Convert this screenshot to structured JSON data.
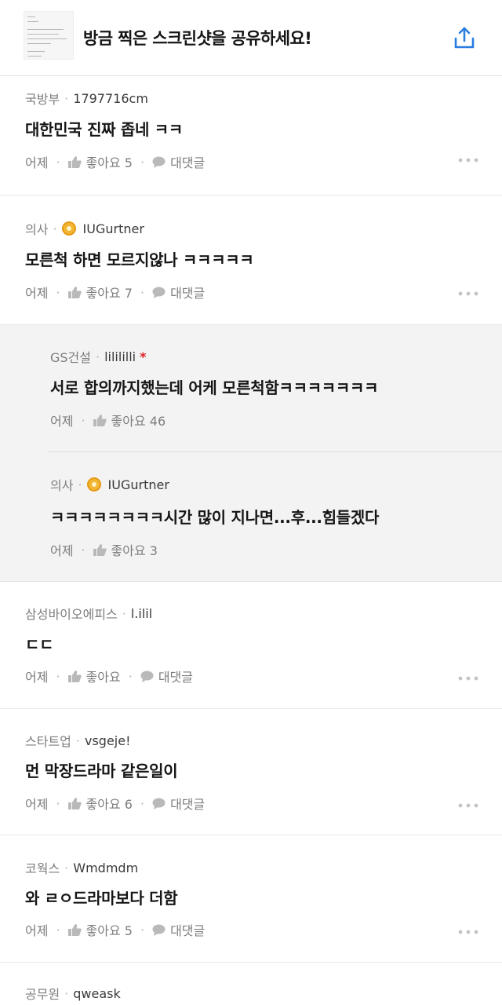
{
  "header": {
    "title": "방금 찍은 스크린샷을 공유하세요!"
  },
  "comments": [
    {
      "company": "국방부",
      "user": "1797716cm",
      "text": "대한민국 진짜 좁네 ㅋㅋ",
      "time": "어제",
      "like": "좋아요 5",
      "reply": "대댓글"
    },
    {
      "company": "의사",
      "user": "IUGurtner",
      "text": "모른척 하면 모르지않나 ㅋㅋㅋㅋㅋ",
      "time": "어제",
      "like": "좋아요 7",
      "reply": "대댓글"
    },
    {
      "company": "GS건설",
      "user": "lilililli",
      "text": "서로 합의까지했는데 어케 모른척함ㅋㅋㅋㅋㅋㅋㅋ",
      "time": "어제",
      "like": "좋아요 46",
      "author_mark": "*"
    },
    {
      "company": "의사",
      "user": "IUGurtner",
      "text": "ㅋㅋㅋㅋㅋㅋㅋㅋ시간 많이 지나면...후...힘들겠다",
      "time": "어제",
      "like": "좋아요 3"
    },
    {
      "company": "삼성바이오에피스",
      "user": "l.ilil",
      "text": "ㄷㄷ",
      "time": "어제",
      "like": "좋아요",
      "reply": "대댓글"
    },
    {
      "company": "스타트업",
      "user": "vsgeje!",
      "text": "먼 막장드라마 같은일이",
      "time": "어제",
      "like": "좋아요 6",
      "reply": "대댓글"
    },
    {
      "company": "코웍스",
      "user": "Wmdmdm",
      "text": "와 ㄹㅇ드라마보다 더함",
      "time": "어제",
      "like": "좋아요 5",
      "reply": "대댓글"
    },
    {
      "company": "공무원",
      "user": "qweask"
    }
  ],
  "icons": {
    "share": "share-icon",
    "like": "thumbs-up-icon",
    "reply": "speech-bubble-icon",
    "more": "more-dots-icon",
    "badge": "verified-badge-icon"
  },
  "colors": {
    "share_icon": "#2a7de1",
    "author_mark": "#e02424",
    "badge": "#f2b632",
    "reply_background": "#f3f3f3"
  }
}
